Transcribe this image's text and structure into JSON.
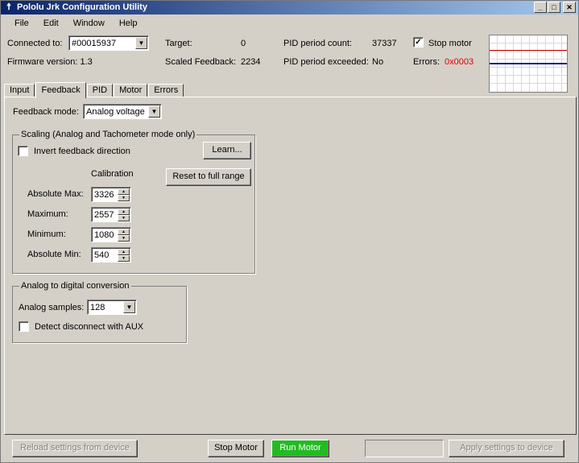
{
  "window": {
    "title": "Pololu Jrk Configuration Utility",
    "controls": {
      "minimize": "_",
      "maximize": "□",
      "close": "✕"
    }
  },
  "menu": [
    "File",
    "Edit",
    "Window",
    "Help"
  ],
  "status": {
    "connected_to_label": "Connected to:",
    "connected_to_value": "#00015937",
    "firmware_label": "Firmware version: 1.3",
    "target_label": "Target:",
    "target_value": "0",
    "scaled_feedback_label": "Scaled Feedback:",
    "scaled_feedback_value": "2234",
    "pid_count_label": "PID period count:",
    "pid_count_value": "37337",
    "pid_exceeded_label": "PID period exceeded:",
    "pid_exceeded_value": "No",
    "stop_motor_label": "Stop motor",
    "stop_motor_checked": true,
    "errors_label": "Errors:",
    "errors_value": "0x0003",
    "error_color": "#e00000"
  },
  "tabs": [
    {
      "label": "Input",
      "active": false
    },
    {
      "label": "Feedback",
      "active": true
    },
    {
      "label": "PID",
      "active": false
    },
    {
      "label": "Motor",
      "active": false
    },
    {
      "label": "Errors",
      "active": false
    }
  ],
  "feedback": {
    "mode_label": "Feedback mode:",
    "mode_value": "Analog voltage",
    "scaling": {
      "title": "Scaling (Analog and Tachometer mode only)",
      "invert_label": "Invert feedback direction",
      "invert_checked": false,
      "learn_button": "Learn...",
      "reset_button": "Reset to full range",
      "calibration_label": "Calibration",
      "rows": [
        {
          "label": "Absolute Max:",
          "value": "3326"
        },
        {
          "label": "Maximum:",
          "value": "2557"
        },
        {
          "label": "Minimum:",
          "value": "1080"
        },
        {
          "label": "Absolute Min:",
          "value": "540"
        }
      ]
    },
    "adc": {
      "title": "Analog to digital conversion",
      "samples_label": "Analog samples:",
      "samples_value": "128",
      "disconnect_label": "Detect disconnect with AUX",
      "disconnect_checked": false
    }
  },
  "footer": {
    "reload_button": "Reload settings from device",
    "stop_motor_button": "Stop Motor",
    "run_motor_button": "Run Motor",
    "run_motor_color": "#22bb22",
    "apply_button": "Apply settings to device"
  }
}
